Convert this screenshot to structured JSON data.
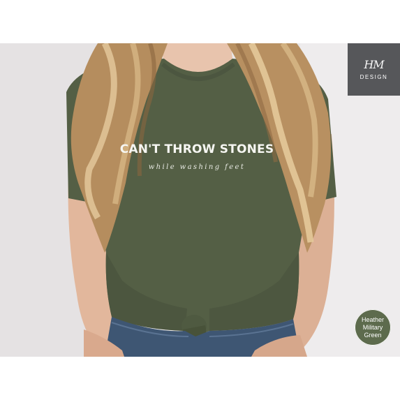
{
  "brand": {
    "mark": "HM",
    "name": "DESIGN"
  },
  "shirt": {
    "headline": "CAN'T THROW STONES",
    "tagline": "while washing feet"
  },
  "swatch": {
    "line1": "Heather",
    "line2": "Military",
    "line3": "Green",
    "color": "#5d6b4d"
  },
  "colors": {
    "shirt": "#545f45",
    "logo_bg": "#56575a",
    "background": "#ebeaea"
  }
}
